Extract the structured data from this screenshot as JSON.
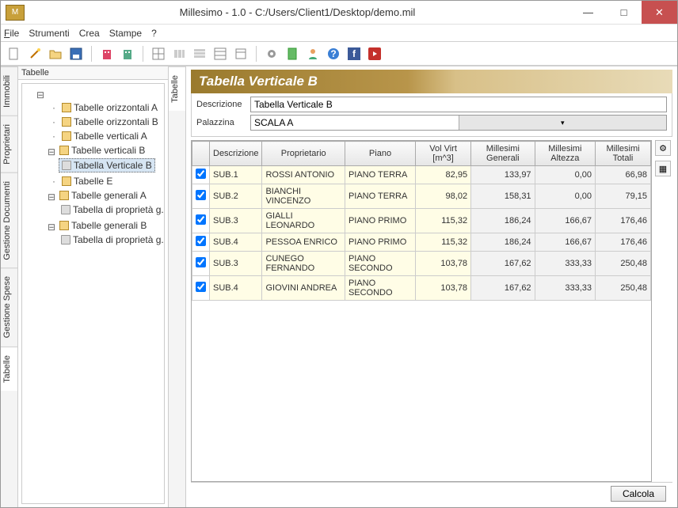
{
  "window": {
    "title": "Millesimo - 1.0 - C:/Users/Client1/Desktop/demo.mil",
    "min": "—",
    "max": "□",
    "close": "✕"
  },
  "menu": {
    "file": "File",
    "strumenti": "Strumenti",
    "crea": "Crea",
    "stampe": "Stampe",
    "help": "?"
  },
  "sidebar_left": {
    "immobili": "Immobili",
    "proprietari": "Proprietari",
    "gestione_documenti": "Gestione Documenti",
    "gestione_spese": "Gestione Spese",
    "tabelle": "Tabelle"
  },
  "tree": {
    "panel_label": "Tabelle",
    "items": {
      "to_a": "Tabelle orizzontali A",
      "to_b": "Tabelle orizzontali B",
      "tv_a": "Tabelle verticali A",
      "tv_b": "Tabelle verticali B",
      "tv_b_child": "Tabella Verticale B",
      "te": "Tabelle E",
      "tg_a": "Tabelle generali A",
      "tg_a_child": "Tabella di proprietà g...",
      "tg_b": "Tabelle generali B",
      "tg_b_child": "Tabella di proprietà g..."
    }
  },
  "detail_tab": "Tabelle",
  "content": {
    "title": "Tabella Verticale B",
    "form": {
      "descrizione_label": "Descrizione",
      "descrizione_value": "Tabella Verticale B",
      "palazzina_label": "Palazzina",
      "palazzina_value": "SCALA A"
    }
  },
  "columns": {
    "c0": "Descrizione",
    "c1": "Proprietario",
    "c2": "Piano",
    "c3": "Vol Virt [m^3]",
    "c4": "Millesimi Generali",
    "c5": "Millesimi Altezza",
    "c6": "Millesimi Totali"
  },
  "rows": [
    {
      "chk": true,
      "desc": "SUB.1",
      "prop": "ROSSI ANTONIO",
      "piano": "PIANO TERRA",
      "vol": "82,95",
      "mg": "133,97",
      "ma": "0,00",
      "mt": "66,98"
    },
    {
      "chk": true,
      "desc": "SUB.2",
      "prop": "BIANCHI VINCENZO",
      "piano": "PIANO TERRA",
      "vol": "98,02",
      "mg": "158,31",
      "ma": "0,00",
      "mt": "79,15"
    },
    {
      "chk": true,
      "desc": "SUB.3",
      "prop": "GIALLI LEONARDO",
      "piano": "PIANO PRIMO",
      "vol": "115,32",
      "mg": "186,24",
      "ma": "166,67",
      "mt": "176,46"
    },
    {
      "chk": true,
      "desc": "SUB.4",
      "prop": "PESSOA ENRICO",
      "piano": "PIANO PRIMO",
      "vol": "115,32",
      "mg": "186,24",
      "ma": "166,67",
      "mt": "176,46"
    },
    {
      "chk": true,
      "desc": "SUB.3",
      "prop": "CUNEGO FERNANDO",
      "piano": "PIANO SECONDO",
      "vol": "103,78",
      "mg": "167,62",
      "ma": "333,33",
      "mt": "250,48"
    },
    {
      "chk": true,
      "desc": "SUB.4",
      "prop": "GIOVINI ANDREA",
      "piano": "PIANO SECONDO",
      "vol": "103,78",
      "mg": "167,62",
      "ma": "333,33",
      "mt": "250,48"
    }
  ],
  "footer": {
    "calcola": "Calcola"
  }
}
